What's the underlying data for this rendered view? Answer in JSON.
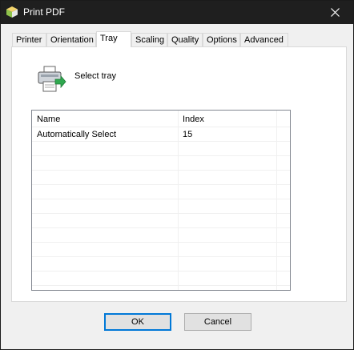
{
  "window": {
    "title": "Print PDF",
    "app_icon": "cube-icon",
    "close_icon": "close-icon"
  },
  "tabs": [
    {
      "label": "Printer",
      "active": false
    },
    {
      "label": "Orientation",
      "active": false
    },
    {
      "label": "Tray",
      "active": true
    },
    {
      "label": "Scaling",
      "active": false
    },
    {
      "label": "Quality",
      "active": false
    },
    {
      "label": "Options",
      "active": false
    },
    {
      "label": "Advanced",
      "active": false
    }
  ],
  "tray": {
    "icon": "printer-icon",
    "label": "Select tray",
    "columns": [
      "Name",
      "Index"
    ],
    "rows": [
      {
        "name": "Automatically Select",
        "index": "15"
      }
    ]
  },
  "buttons": {
    "ok": "OK",
    "cancel": "Cancel"
  }
}
